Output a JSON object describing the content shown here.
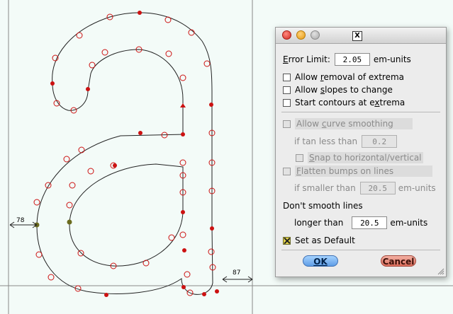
{
  "glyph": {
    "measure_left": "78",
    "measure_right": "87"
  },
  "dialog": {
    "error_limit": {
      "label_underline": "E",
      "label_rest": "rror Limit:",
      "value": "2.05",
      "unit": "em-units"
    },
    "allow_removal": {
      "pre": "Allow ",
      "u": "r",
      "post": "emoval of extrema"
    },
    "allow_slopes": {
      "pre": "Allow ",
      "u": "s",
      "post": "lopes to change"
    },
    "start_contours": {
      "pre": "Start contours at e",
      "u": "x",
      "post": "trema"
    },
    "allow_curve": {
      "pre": "Allow ",
      "u": "c",
      "post": "urve smoothing"
    },
    "tan_label": "if tan less than",
    "tan_value": "0.2",
    "snap": {
      "u": "S",
      "post": "nap to horizontal/vertical"
    },
    "flatten": {
      "u": "F",
      "post": "latten bumps on lines"
    },
    "smaller_label": "if smaller than",
    "smaller_value": "20.5",
    "smaller_unit": "em-units",
    "dont_smooth": "Don't smooth lines",
    "longer_label": "longer than",
    "longer_value": "20.5",
    "longer_unit": "em-units",
    "set_default": "Set as Default",
    "ok_label": "OK",
    "cancel_label": "Cancel"
  }
}
